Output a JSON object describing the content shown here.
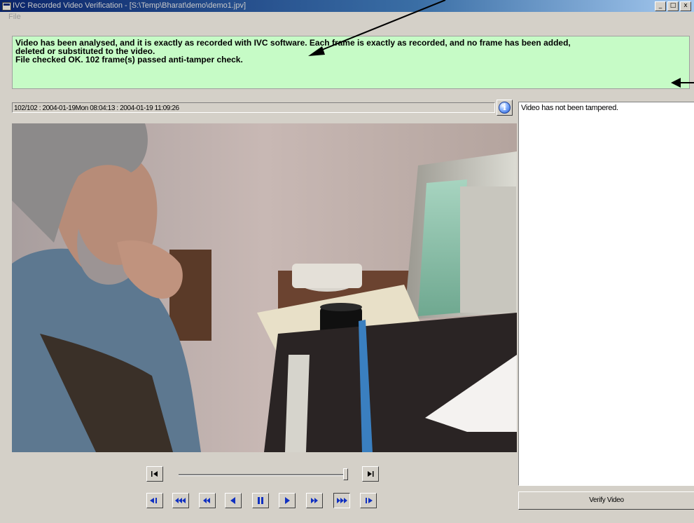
{
  "window": {
    "title": "IVC Recorded Video Verification - [S:\\Temp\\Bharat\\demo\\demo1.jpv]",
    "buttons": [
      "_",
      "□",
      "x"
    ]
  },
  "menu": {
    "file": "File"
  },
  "message": {
    "line1": "Video has been analysed, and it is exactly as recorded with IVC software.  Each frame is exactly as recorded, and no frame has been added,",
    "line2": "deleted or substituted to the video.",
    "line3": "File checked OK.  102 frame(s) passed anti-tamper check."
  },
  "status": {
    "frame_info": "102/102 : 2004-01-19Mon 08:04:13 : 2004-01-19 11:09:26"
  },
  "info_button": {
    "icon": "info-icon",
    "glyph": "i"
  },
  "log": {
    "text": "Video has not been tampered."
  },
  "verify_button": {
    "label": "Verify Video"
  },
  "slider": {
    "position_fraction": 0.99
  },
  "controls": {
    "icons": [
      "step-back-icon",
      "fast-rewind-icon",
      "rewind-icon",
      "reverse-play-icon",
      "pause-icon",
      "play-icon",
      "fast-forward-icon",
      "faster-forward-icon",
      "step-forward-icon"
    ]
  },
  "colors": {
    "message_bg": "#c6fbc6",
    "window_bg": "#d4d0c8",
    "titlebar_start": "#0a246a"
  }
}
